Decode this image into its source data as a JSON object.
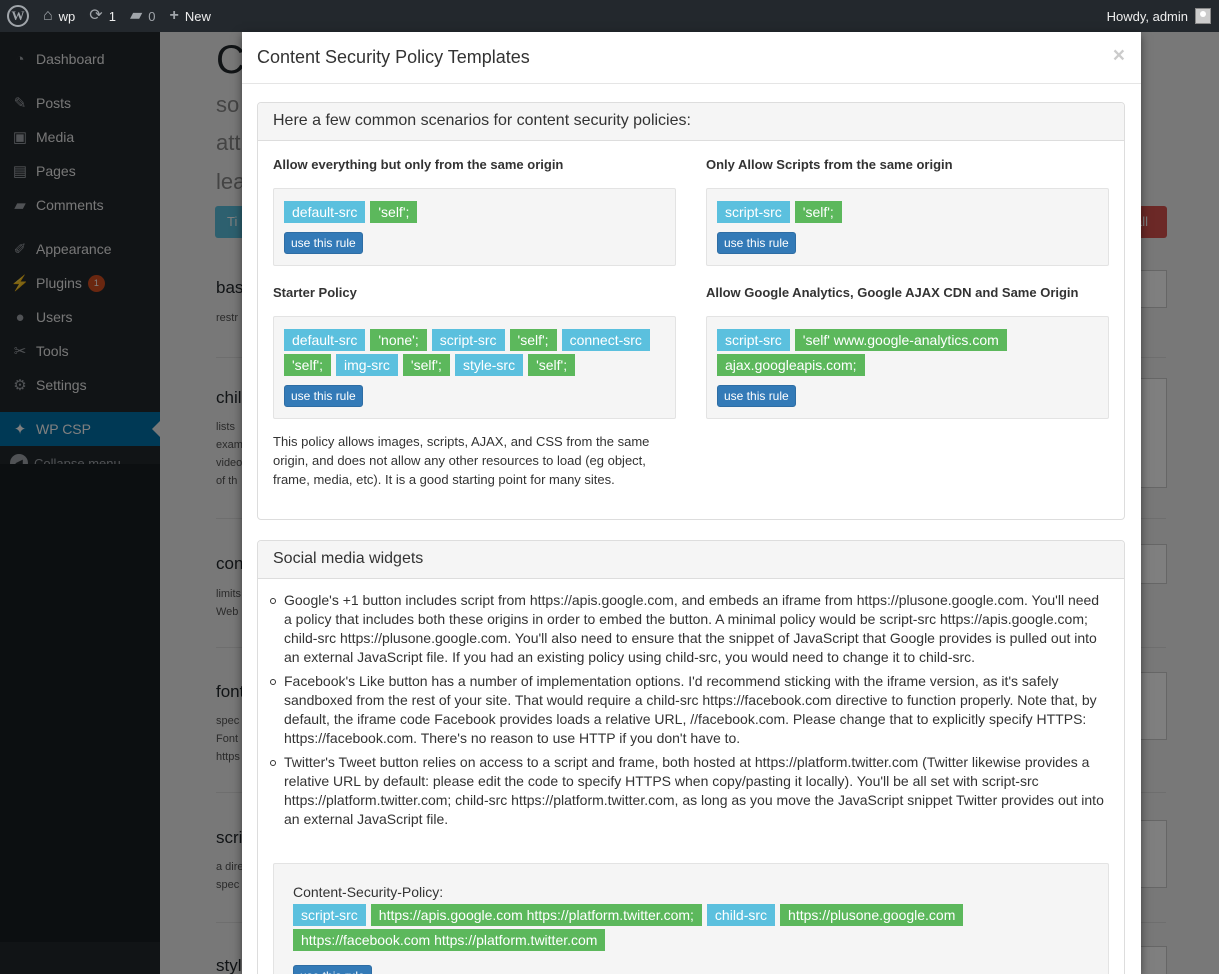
{
  "adminbar": {
    "site_name": "wp",
    "updates_count": "1",
    "comments_count": "0",
    "new_label": "New",
    "howdy": "Howdy, admin"
  },
  "sidebar": {
    "items": [
      {
        "label": "Dashboard",
        "icon": "dashboard-icon"
      },
      {
        "label": "Posts",
        "icon": "pin-icon"
      },
      {
        "label": "Media",
        "icon": "media-icon"
      },
      {
        "label": "Pages",
        "icon": "pages-icon"
      },
      {
        "label": "Comments",
        "icon": "comment-icon"
      },
      {
        "label": "Appearance",
        "icon": "paintbrush-icon"
      },
      {
        "label": "Plugins",
        "icon": "plugin-icon",
        "badge": "1"
      },
      {
        "label": "Users",
        "icon": "user-icon"
      },
      {
        "label": "Tools",
        "icon": "wrench-icon"
      },
      {
        "label": "Settings",
        "icon": "settings-icon"
      },
      {
        "label": "WP CSP",
        "icon": "wpcsp-icon"
      }
    ],
    "collapse": "Collapse menu"
  },
  "background": {
    "title": "C",
    "intro1": "so",
    "intro2": "att",
    "intro3": "lea",
    "btn_left": "Ti",
    "btn_right": "all",
    "sections": [
      {
        "heading": "bas",
        "lines": [
          "restr"
        ]
      },
      {
        "heading": "chil",
        "lines": [
          "lists",
          "exam",
          "video",
          "of th"
        ]
      },
      {
        "heading": "con",
        "lines": [
          "limits",
          "Web"
        ]
      },
      {
        "heading": "font",
        "lines": [
          "spec",
          "Font",
          "https"
        ]
      },
      {
        "heading": "scri",
        "lines": [
          "a dire",
          "spec"
        ]
      },
      {
        "heading": "styl",
        "lines": []
      }
    ]
  },
  "modal": {
    "title": "Content Security Policy Templates",
    "close": "×",
    "common_heading": "Here a few common scenarios for content security policies:",
    "use_rule": "use this rule",
    "scenarios": [
      {
        "title": "Allow everything but only from the same origin",
        "tags": [
          {
            "text": "default-src",
            "kind": "blue"
          },
          {
            "text": "'self';",
            "kind": "green"
          }
        ]
      },
      {
        "title": "Only Allow Scripts from the same origin",
        "tags": [
          {
            "text": "script-src",
            "kind": "blue"
          },
          {
            "text": "'self';",
            "kind": "green"
          }
        ]
      },
      {
        "title": "Starter Policy",
        "tags": [
          {
            "text": "default-src",
            "kind": "blue"
          },
          {
            "text": "'none';",
            "kind": "green"
          },
          {
            "text": "script-src",
            "kind": "blue"
          },
          {
            "text": "'self';",
            "kind": "green"
          },
          {
            "text": "connect-src",
            "kind": "blue"
          },
          {
            "text": "'self';",
            "kind": "green"
          },
          {
            "text": "img-src",
            "kind": "blue"
          },
          {
            "text": "'self';",
            "kind": "green"
          },
          {
            "text": "style-src",
            "kind": "blue"
          },
          {
            "text": "'self';",
            "kind": "green"
          }
        ],
        "description": "This policy allows images, scripts, AJAX, and CSS from the same origin, and does not allow any other resources to load (eg object, frame, media, etc). It is a good starting point for many sites."
      },
      {
        "title": "Allow Google Analytics, Google AJAX CDN and Same Origin",
        "tags": [
          {
            "text": "script-src",
            "kind": "blue"
          },
          {
            "text": "'self' www.google-analytics.com",
            "kind": "green"
          },
          {
            "text": "ajax.googleapis.com;",
            "kind": "green"
          }
        ]
      }
    ],
    "social": {
      "heading": "Social media widgets",
      "items": [
        "Google's +1 button includes script from https://apis.google.com, and embeds an iframe from https://plusone.google.com. You'll need a policy that includes both these origins in order to embed the button. A minimal policy would be script-src https://apis.google.com; child-src https://plusone.google.com. You'll also need to ensure that the snippet of JavaScript that Google provides is pulled out into an external JavaScript file. If you had an existing policy using child-src, you would need to change it to child-src.",
        "Facebook's Like button has a number of implementation options. I'd recommend sticking with the iframe version, as it's safely sandboxed from the rest of your site. That would require a child-src https://facebook.com directive to function properly. Note that, by default, the iframe code Facebook provides loads a relative URL, //facebook.com. Please change that to explicitly specify HTTPS: https://facebook.com. There's no reason to use HTTP if you don't have to.",
        "Twitter's Tweet button relies on access to a script and frame, both hosted at https://platform.twitter.com (Twitter likewise provides a relative URL by default: please edit the code to specify HTTPS when copy/pasting it locally). You'll be all set with script-src https://platform.twitter.com; child-src https://platform.twitter.com, as long as you move the JavaScript snippet Twitter provides out into an external JavaScript file."
      ],
      "csp_label": "Content-Security-Policy:",
      "csp_tags": [
        {
          "text": "script-src",
          "kind": "blue"
        },
        {
          "text": "https://apis.google.com https://platform.twitter.com;",
          "kind": "green"
        },
        {
          "text": "child-src",
          "kind": "blue"
        },
        {
          "text": "https://plusone.google.com",
          "kind": "green"
        },
        {
          "text": "https://facebook.com https://platform.twitter.com",
          "kind": "green"
        }
      ]
    }
  },
  "colors": {
    "admin_dark": "#23282d",
    "active_blue": "#0073aa",
    "label_info": "#5bc0de",
    "label_success": "#5cb85c",
    "btn_primary": "#337ab7"
  }
}
